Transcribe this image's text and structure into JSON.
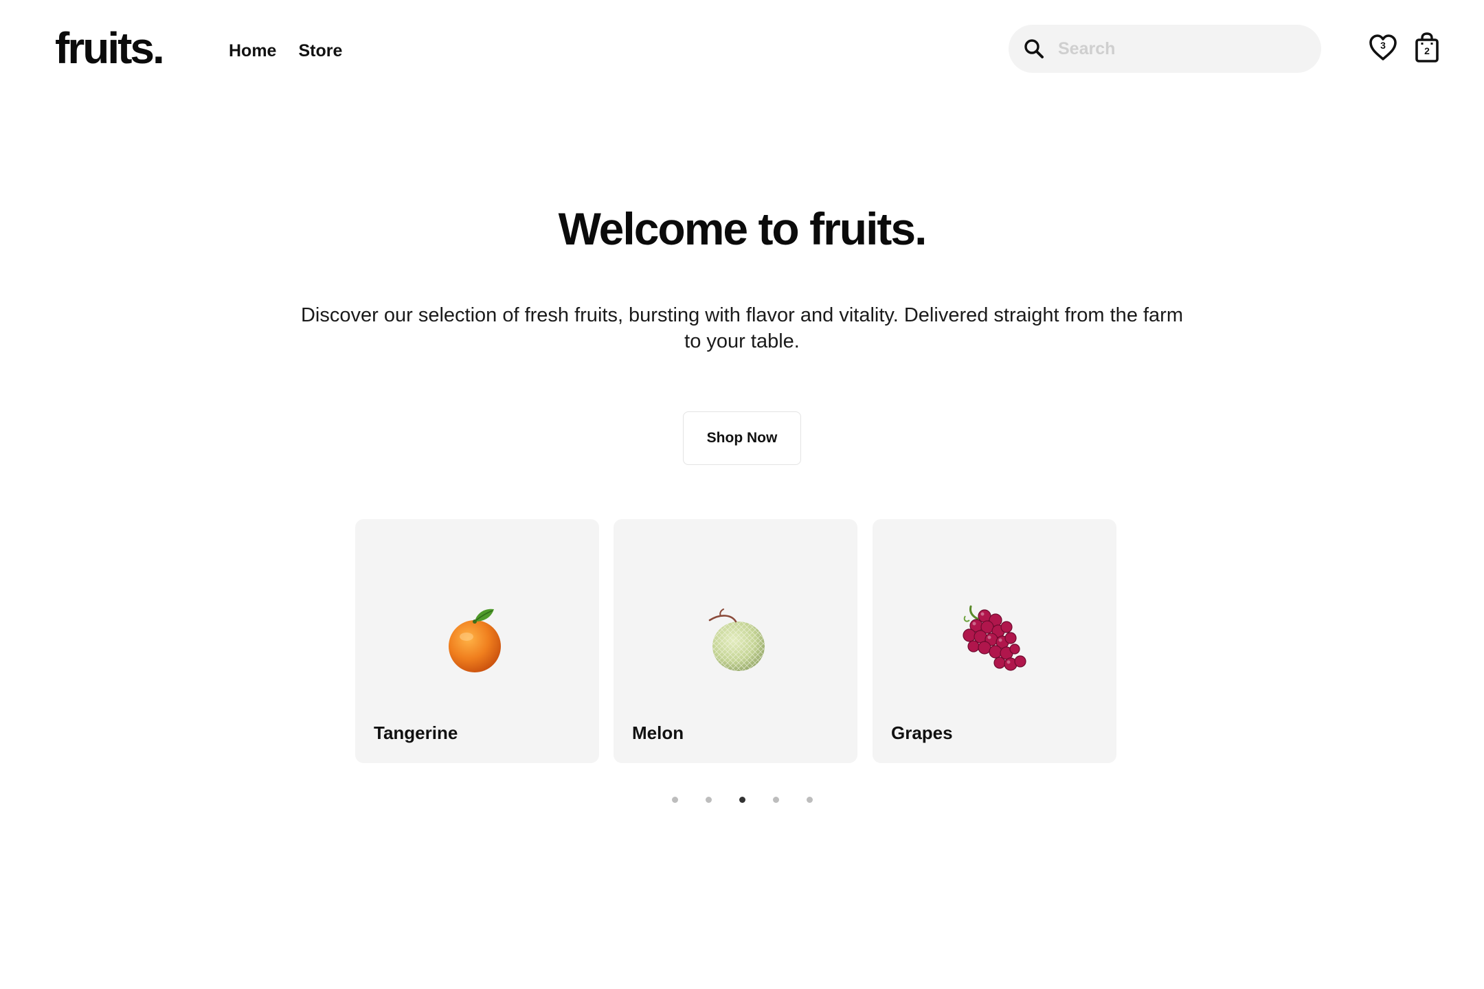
{
  "header": {
    "logo": "fruits.",
    "nav": [
      {
        "label": "Home"
      },
      {
        "label": "Store"
      }
    ],
    "search": {
      "placeholder": "Search",
      "value": ""
    },
    "wishlist": {
      "icon": "heart-icon",
      "count": "3"
    },
    "cart": {
      "icon": "shopping-bag-icon",
      "count": "2"
    }
  },
  "hero": {
    "title": "Welcome to fruits.",
    "subtitle": "Discover our selection of fresh fruits, bursting with flavor and vitality. Delivered straight from the farm to your table.",
    "cta": "Shop Now"
  },
  "carousel": {
    "cards": [
      {
        "name": "Tangerine",
        "icon": "tangerine-icon"
      },
      {
        "name": "Melon",
        "icon": "melon-icon"
      },
      {
        "name": "Grapes",
        "icon": "grapes-icon"
      }
    ],
    "page_count": 5,
    "active_page": 3
  },
  "colors": {
    "text": "#111111",
    "card_bg": "#f4f4f4",
    "search_bg": "#f3f3f3",
    "dot_active": "#333333",
    "dot_inactive": "#bdbdbd"
  }
}
